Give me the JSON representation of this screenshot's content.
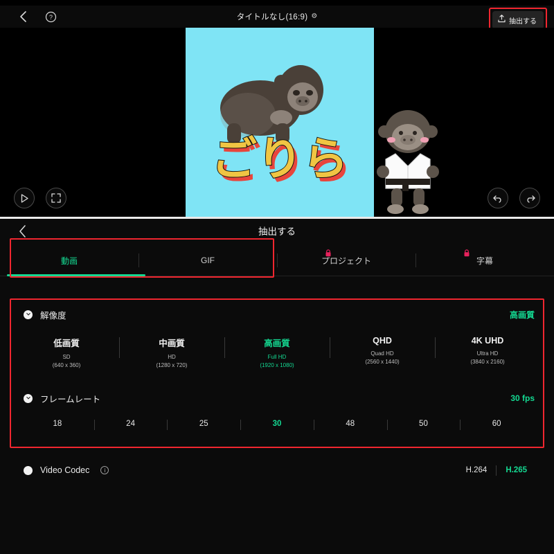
{
  "editor": {
    "topbar": {
      "back_icon": "chevron-left-icon",
      "help_icon": "help-circle-icon",
      "title": "タイトルなし(16:9)",
      "gear_icon": "gear-icon",
      "export_label": "抽出する",
      "export_icon": "export-upload-icon"
    },
    "controls": {
      "play_icon": "play-icon",
      "fullscreen_icon": "fullscreen-icon",
      "undo_icon": "undo-icon",
      "redo_icon": "redo-icon"
    },
    "preview": {
      "canvas_bg": "#7fe4f5",
      "title_text": "ごりら",
      "title_fill": "#f0c543",
      "title_shadow": "#e8453c"
    }
  },
  "panel": {
    "back_icon": "chevron-left-icon",
    "title": "抽出する",
    "tabs": [
      {
        "label": "動画",
        "active": true,
        "locked": false
      },
      {
        "label": "GIF",
        "active": false,
        "locked": false
      },
      {
        "label": "プロジェクト",
        "active": false,
        "locked": true
      },
      {
        "label": "字幕",
        "active": false,
        "locked": true
      }
    ],
    "resolution": {
      "label": "解像度",
      "value": "高画質",
      "options": [
        {
          "main": "低画質",
          "name": "SD",
          "dims": "(640 x 360)",
          "selected": false
        },
        {
          "main": "中画質",
          "name": "HD",
          "dims": "(1280 x 720)",
          "selected": false
        },
        {
          "main": "高画質",
          "name": "Full HD",
          "dims": "(1920 x 1080)",
          "selected": true
        },
        {
          "main": "QHD",
          "name": "Quad HD",
          "dims": "(2560 x 1440)",
          "selected": false
        },
        {
          "main": "4K UHD",
          "name": "Ultra HD",
          "dims": "(3840 x 2160)",
          "selected": false
        }
      ]
    },
    "framerate": {
      "label": "フレームレート",
      "value": "30 fps",
      "options": [
        {
          "label": "18",
          "selected": false
        },
        {
          "label": "24",
          "selected": false
        },
        {
          "label": "25",
          "selected": false
        },
        {
          "label": "30",
          "selected": true
        },
        {
          "label": "48",
          "selected": false
        },
        {
          "label": "50",
          "selected": false
        },
        {
          "label": "60",
          "selected": false
        }
      ]
    },
    "codec": {
      "label": "Video Codec",
      "info_icon": "info-icon",
      "options": [
        {
          "label": "H.264",
          "selected": false
        },
        {
          "label": "H.265",
          "selected": true
        }
      ]
    }
  },
  "colors": {
    "accent_green": "#14d992",
    "annotation_red": "#f0262f",
    "lock_pink": "#e8215c",
    "panel_bg": "#0b0b0b"
  }
}
